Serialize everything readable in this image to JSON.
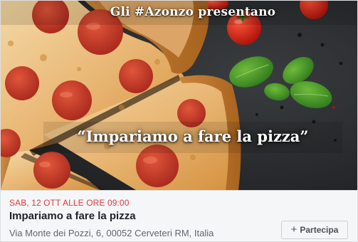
{
  "event": {
    "cover": {
      "headline": "Gli #Azonzo presentano",
      "title": "“Impariamo a fare la pizza”"
    },
    "date": "SAB, 12 OTT ALLE ORE 09:00",
    "title": "Impariamo a fare la pizza",
    "location": "Via Monte dei Pozzi, 6, 00052 Cerveteri RM, Italia",
    "join_button": {
      "icon": "plus-icon",
      "icon_glyph": "+",
      "label": "Partecipa"
    }
  },
  "colors": {
    "date": "#e0393e",
    "title": "#1d2129",
    "location": "#606770",
    "button_border": "#ccd0d5",
    "details_bg": "#f5f6f7"
  }
}
